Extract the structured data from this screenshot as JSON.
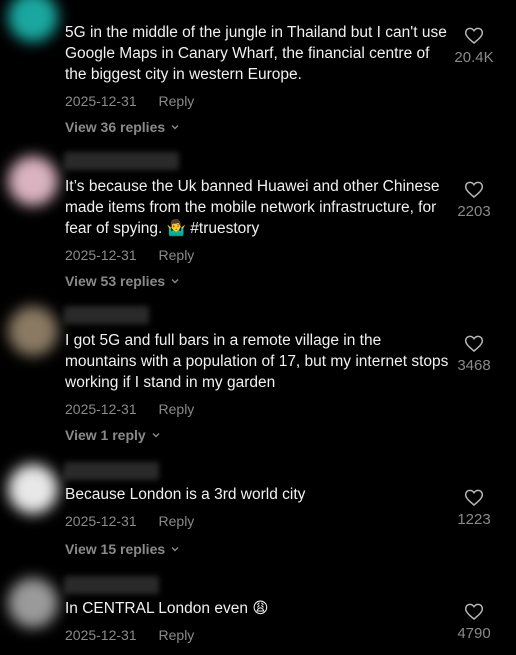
{
  "comments": [
    {
      "text": "5G in the middle of the jungle in Thailand but I can't use Google Maps in Canary Wharf, the financial centre of the biggest city in western Europe.",
      "date": "2025-12-31",
      "reply_label": "Reply",
      "replies_label": "View 36 replies",
      "likes": "20.4K",
      "avatar_color": "#1aa7a0"
    },
    {
      "text": "It’s because the Uk banned Huawei and other Chinese made items from the mobile network infrastructure, for fear of spying. 🤷‍♂️ #truestory",
      "date": "2025-12-31",
      "reply_label": "Reply",
      "replies_label": "View 53 replies",
      "likes": "2203",
      "avatar_color": "#d9b3bf"
    },
    {
      "text": "I got 5G and full bars in a remote village in the mountains with a population of 17, but my internet stops working if I stand in my garden",
      "date": "2025-12-31",
      "reply_label": "Reply",
      "replies_label": "View 1 reply",
      "likes": "3468",
      "avatar_color": "#8a7a63"
    },
    {
      "text": "Because London is a 3rd world city",
      "date": "2025-12-31",
      "reply_label": "Reply",
      "replies_label": "View 15 replies",
      "likes": "1223",
      "avatar_color": "#e8e8e8"
    },
    {
      "text": "In CENTRAL London even 😩",
      "date": "2025-12-31",
      "reply_label": "Reply",
      "likes": "4790",
      "avatar_color": "#9a9a9a"
    }
  ]
}
